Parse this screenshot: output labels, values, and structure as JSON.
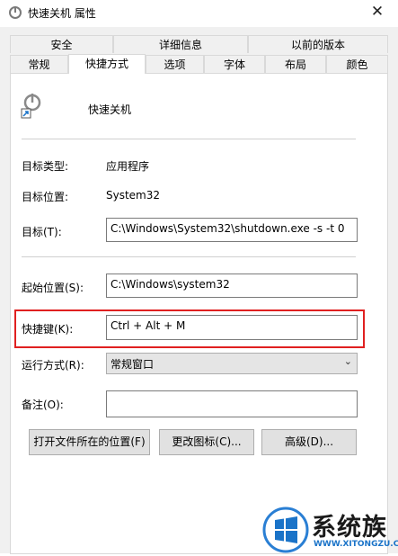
{
  "window": {
    "title": "快速关机 属性",
    "close_glyph": "✕"
  },
  "tabs_row1": [
    "安全",
    "详细信息",
    "以前的版本"
  ],
  "tabs_row2": [
    "常规",
    "快捷方式",
    "选项",
    "字体",
    "布局",
    "颜色"
  ],
  "active_tab": "快捷方式",
  "shortcut": {
    "name": "快速关机",
    "target_type_label": "目标类型:",
    "target_type_value": "应用程序",
    "target_location_label": "目标位置:",
    "target_location_value": "System32",
    "target_label": "目标(T):",
    "target_value": "C:\\Windows\\System32\\shutdown.exe -s -t 0",
    "start_in_label": "起始位置(S):",
    "start_in_value": "C:\\Windows\\system32",
    "hotkey_label": "快捷键(K):",
    "hotkey_value": "Ctrl + Alt + M",
    "run_label": "运行方式(R):",
    "run_value": "常规窗口",
    "comment_label": "备注(O):",
    "comment_value": ""
  },
  "buttons": {
    "open_location": "打开文件所在的位置(F)",
    "change_icon": "更改图标(C)...",
    "advanced": "高级(D)..."
  },
  "watermark": {
    "brand": "系统族",
    "url": "WWW.XITONGZU.COM"
  },
  "colors": {
    "highlight": "#e02020",
    "win_blue": "#1a73c8"
  }
}
